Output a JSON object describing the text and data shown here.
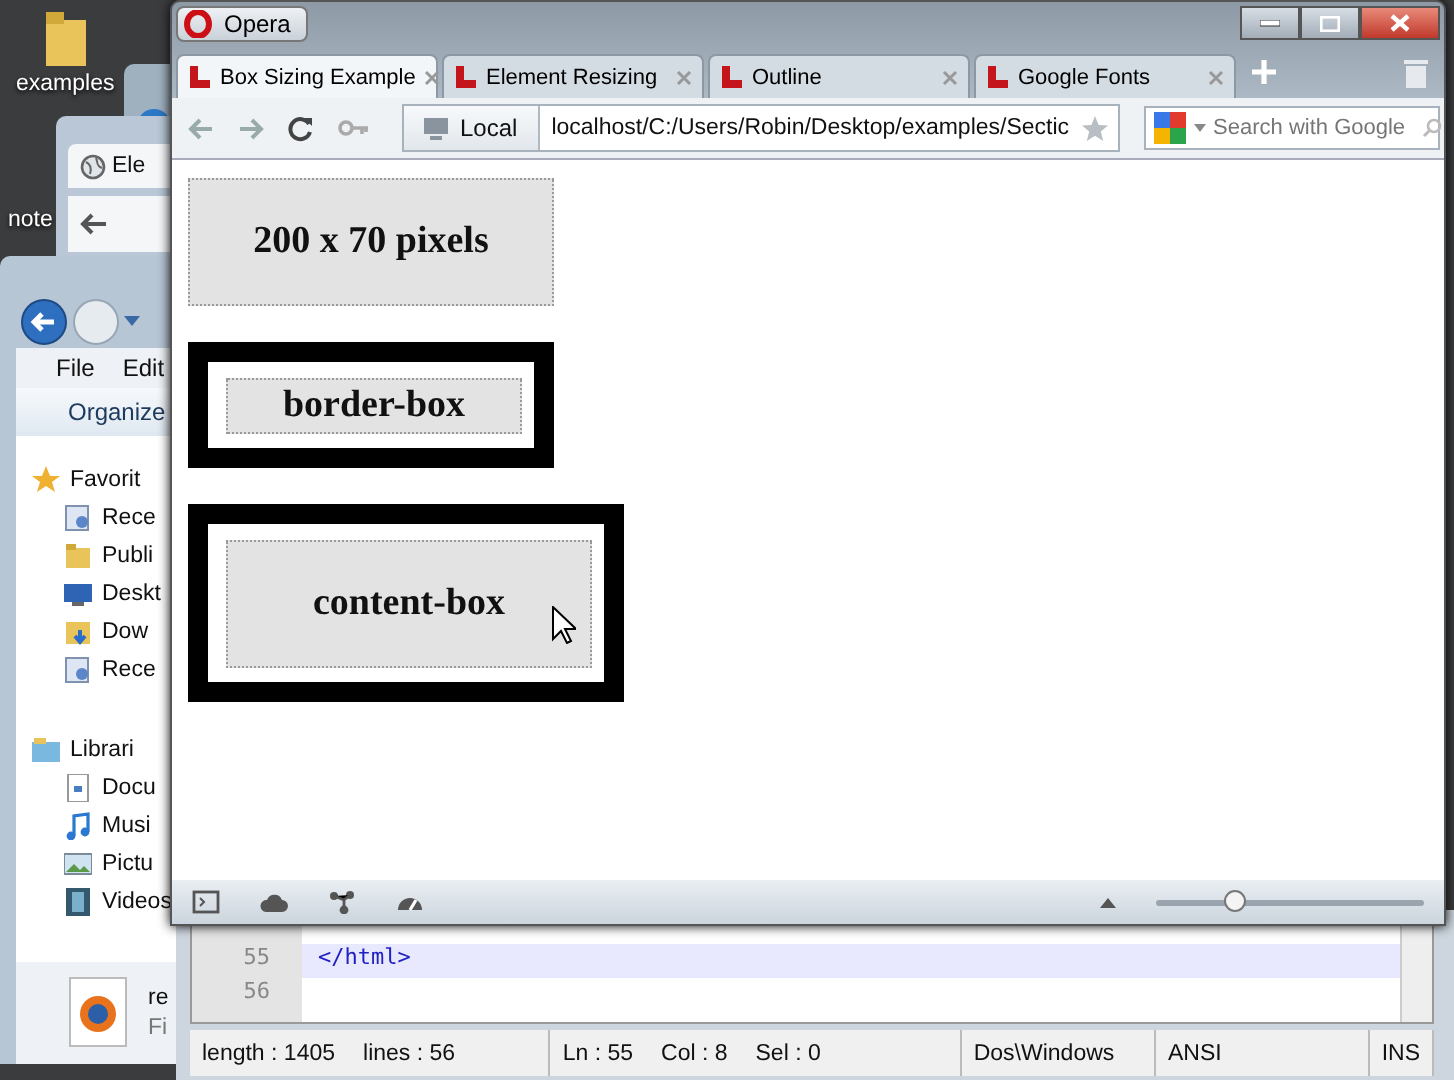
{
  "desktop": {
    "icons": [
      {
        "kind": "folder",
        "label": "examples"
      },
      {
        "kind": "file",
        "label": "note"
      }
    ]
  },
  "chrome_window": {
    "tab": "Ele"
  },
  "explorer": {
    "menu": [
      "File",
      "Edit"
    ],
    "toolbar": "Organize",
    "nav": [
      {
        "kind": "favorites",
        "label": "Favorit",
        "children": [
          {
            "kind": "recent",
            "label": "Rece"
          },
          {
            "kind": "folder",
            "label": "Publi"
          },
          {
            "kind": "desktop",
            "label": "Deskt"
          },
          {
            "kind": "downloads",
            "label": "Dow"
          },
          {
            "kind": "recent",
            "label": "Rece"
          }
        ]
      },
      {
        "kind": "libraries",
        "label": "Librari",
        "children": [
          {
            "kind": "documents",
            "label": "Docu"
          },
          {
            "kind": "music",
            "label": "Musi"
          },
          {
            "kind": "pictures",
            "label": "Pictu"
          },
          {
            "kind": "videos",
            "label": "Videos"
          }
        ]
      }
    ],
    "details": {
      "name": "re",
      "type": "Fi"
    }
  },
  "notepad": {
    "lines": [
      {
        "number": "55",
        "code": "</html>",
        "current": true
      },
      {
        "number": "56",
        "current": false
      }
    ],
    "status": [
      [
        "length : 1405",
        "lines : 56"
      ],
      [
        "Ln : 55",
        "Col : 8",
        "Sel : 0"
      ],
      [
        "Dos\\Windows"
      ],
      [
        "ANSI"
      ],
      [
        "INS"
      ]
    ]
  },
  "opera": {
    "menu_button": "Opera",
    "tabs": [
      {
        "label": "Box Sizing Example",
        "selected": true
      },
      {
        "label": "Element Resizing",
        "selected": false
      },
      {
        "label": "Outline",
        "selected": false
      },
      {
        "label": "Google Fonts",
        "selected": false
      }
    ],
    "address": {
      "badge": "Local",
      "url": "localhost/C:/Users/Robin/Desktop/examples/Sectic"
    },
    "search": {
      "placeholder": "Search with Google"
    },
    "page": {
      "boxes": [
        {
          "kind": "plain",
          "text": "200 x 70 pixels"
        },
        {
          "kind": "border-box",
          "text": "border-box"
        },
        {
          "kind": "content-box",
          "text": "content-box"
        }
      ]
    },
    "zoom": {
      "level": 0.29
    }
  }
}
